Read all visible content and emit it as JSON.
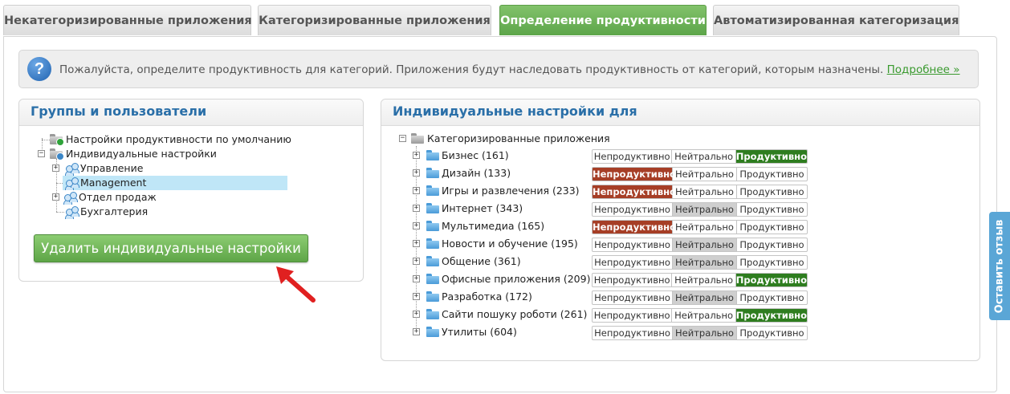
{
  "tabs": [
    {
      "label": "Некатегоризированные приложения",
      "active": false
    },
    {
      "label": "Категоризированные приложения",
      "active": false
    },
    {
      "label": "Определение продуктивности",
      "active": true
    },
    {
      "label": "Автоматизированная категоризация",
      "active": false
    }
  ],
  "info": {
    "icon": "question-icon",
    "text": "Пожалуйста, определите продуктивность для категорий. Приложения будут наследовать продуктивность от категорий, которым назначены.",
    "link": "Подробнее »"
  },
  "groups_panel": {
    "title": "Группы и пользователи",
    "tree": [
      {
        "label": "Настройки продуктивности по умолчанию",
        "icon": "settings-folder-icon"
      },
      {
        "label": "Индивидуальные настройки",
        "icon": "settings-folder-icon",
        "expanded": true
      },
      {
        "label": "Управление",
        "icon": "users-icon",
        "expandable": true
      },
      {
        "label": "Management",
        "icon": "users-icon",
        "selected": true
      },
      {
        "label": "Отдел продаж",
        "icon": "users-icon",
        "expandable": true
      },
      {
        "label": "Бухгалтерия",
        "icon": "users-icon"
      }
    ],
    "delete_button": "Удалить индивидуальные настройки"
  },
  "settings_panel": {
    "title": "Индивидуальные настройки для",
    "root_label": "Категоризированные приложения",
    "options": [
      "Непродуктивно",
      "Нейтрально",
      "Продуктивно"
    ],
    "categories": [
      {
        "label": "Бизнес (161)",
        "selected": "Продуктивно"
      },
      {
        "label": "Дизайн (133)",
        "selected": "Непродуктивно"
      },
      {
        "label": "Игры и развлечения (233)",
        "selected": "Непродуктивно"
      },
      {
        "label": "Интернет (343)",
        "selected": "Нейтрально"
      },
      {
        "label": "Мультимедиа (165)",
        "selected": "Непродуктивно"
      },
      {
        "label": "Новости и обучение (195)",
        "selected": "Нейтрально"
      },
      {
        "label": "Общение (361)",
        "selected": "Нейтрально"
      },
      {
        "label": "Офисные приложения (209)",
        "selected": "Продуктивно"
      },
      {
        "label": "Разработка (172)",
        "selected": "Нейтрально"
      },
      {
        "label": "Сайти пошуку роботи (261)",
        "selected": "Продуктивно"
      },
      {
        "label": "Утилиты (604)",
        "selected": "Нейтрально"
      }
    ]
  },
  "feedback_tab": "Оставить отзыв",
  "colors": {
    "active_tab": "#6db35a",
    "title_blue": "#2a6fa8",
    "unproductive": "#a63e26",
    "productive": "#2e7d1f",
    "neutral": "#cfcfcf"
  }
}
